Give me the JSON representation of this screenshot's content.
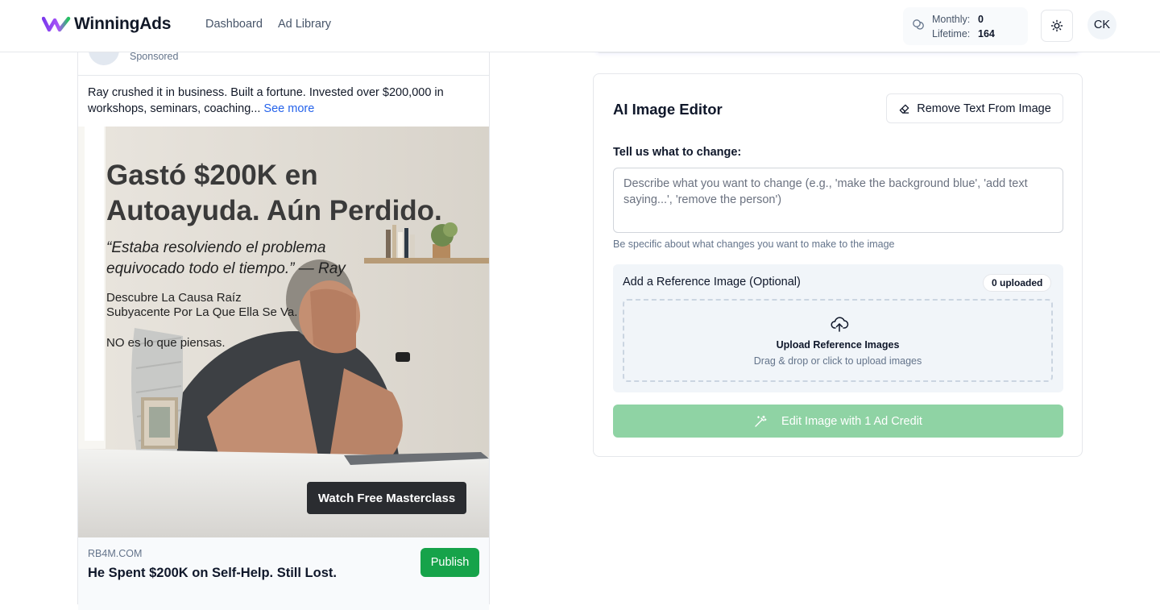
{
  "app": {
    "name": "WinningAds",
    "brand_colors": [
      "#7c3aed",
      "#a855f7",
      "#22c55e"
    ]
  },
  "nav": {
    "items": [
      {
        "label": "Dashboard"
      },
      {
        "label": "Ad Library"
      }
    ]
  },
  "credits": {
    "monthly_label": "Monthly:",
    "monthly_value": "0",
    "lifetime_label": "Lifetime:",
    "lifetime_value": "164",
    "icon": "coins-icon"
  },
  "header": {
    "theme_icon": "sun-icon",
    "user_initials": "CK"
  },
  "ad_preview": {
    "sponsored_label": "Sponsored",
    "body_text": "Ray crushed it in business. Built a fortune. Invested over $200,000 in workshops, seminars, coaching... ",
    "see_more": "See more",
    "image": {
      "headline_line1": "Gastó $200K en",
      "headline_line2": "Autoayuda. Aún Perdido.",
      "quote_line1": "“Estaba resolviendo el problema",
      "quote_line2": "equivocado todo el tiempo.” — Ray",
      "sub_line1": "Descubre La Causa Raíz",
      "sub_line2": "Subyacente Por La Que Ella Se Va.",
      "tag_line": "NO es lo que piensas.",
      "cta": "Watch Free Masterclass"
    },
    "domain": "RB4M.COM",
    "headline": "He Spent $200K on Self-Help. Still Lost.",
    "publish_label": "Publish",
    "publish_color": "#16a34a"
  },
  "editor": {
    "title": "AI Image Editor",
    "remove_text_label": "Remove Text From Image",
    "remove_text_icon": "eraser-icon",
    "field_label": "Tell us what to change:",
    "prompt_placeholder": "Describe what you want to change (e.g., 'make the background blue', 'add text saying...', 'remove the person')",
    "prompt_value": "",
    "hint": "Be specific about what changes you want to make to the image",
    "reference": {
      "title": "Add a Reference Image (Optional)",
      "badge": "0 uploaded",
      "upload_icon": "cloud-upload-icon",
      "upload_title": "Upload Reference Images",
      "upload_sub": "Drag & drop or click to upload images"
    },
    "submit_label": "Edit Image with 1 Ad Credit",
    "submit_icon": "magic-wand-icon",
    "submit_color": "#8fd3a4"
  }
}
